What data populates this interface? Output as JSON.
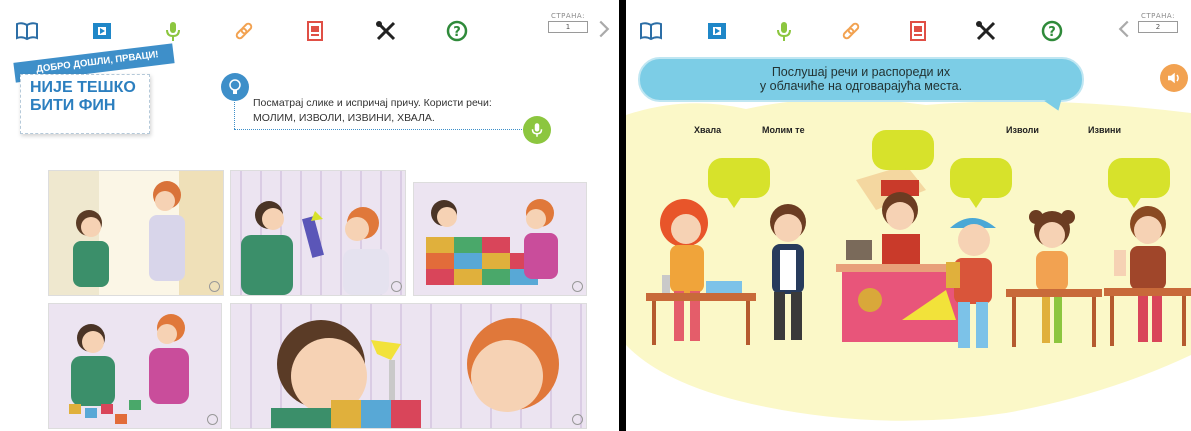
{
  "left_screen": {
    "toolbar_icons": [
      "book-icon",
      "film-icon",
      "microphone-icon",
      "link-icon",
      "notebook-icon",
      "tools-icon",
      "help-icon"
    ],
    "page_label": "СТРАНА:",
    "page_number": "1",
    "welcome": "ДОБРО ДОШЛИ, ПРВАЦИ!",
    "title": "НИЈЕ ТЕШКО\nБИТИ ФИН",
    "instruction_line1": "Посматрај слике и испричај причу. Користи речи:",
    "instruction_line2": "МОЛИМ, ИЗВОЛИ, ИЗВИНИ, ХВАЛА."
  },
  "right_screen": {
    "page_label": "СТРАНА:",
    "page_number": "2",
    "task_line1": "Послушај речи и распореди их",
    "task_line2": "у облачиће на одговарајућа места.",
    "words": [
      "Хвала",
      "Молим те",
      "Изволи",
      "Извини"
    ]
  },
  "colors": {
    "blue": "#3e8fc9",
    "green": "#8cc63f",
    "bubble_yellow": "#d7e22b",
    "speech_blue": "#7ccde6",
    "speaker_orange": "#f2a251",
    "cloud_yellow": "#fbf8c8"
  }
}
